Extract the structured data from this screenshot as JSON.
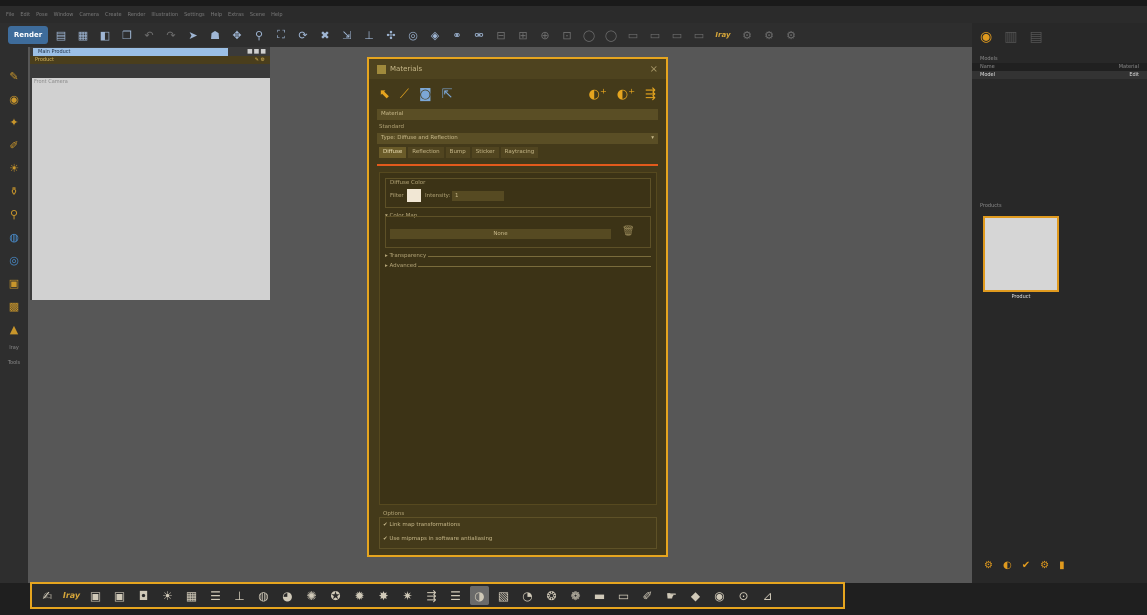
{
  "menubar": {
    "items": [
      "File",
      "Edit",
      "Pose",
      "Window",
      "Camera",
      "Create",
      "Render",
      "Illustration",
      "Settings",
      "Help",
      "Extras",
      "Scene",
      "Help"
    ]
  },
  "toolbar": {
    "render_label": "Render",
    "iray_label": "Iray"
  },
  "left_strip": {
    "label_a": "Iray",
    "label_b": "Tools"
  },
  "scene": {
    "tab_label": "Main Product",
    "controls": "■■■",
    "sub_label": "Product",
    "view_label": "Front Camera"
  },
  "right_panel": {
    "section_title": "Models",
    "header_cols": [
      "Name",
      "Material"
    ],
    "selected_row": [
      "Model",
      "Edit"
    ],
    "products_title": "Products",
    "product_label": "Product"
  },
  "dialog": {
    "title": "Materials",
    "close": "×",
    "material_field": "Material",
    "standard_label": "Standard",
    "type_label": "Type:",
    "type_value": "Diffuse and Reflection",
    "tabs": [
      "Diffuse",
      "Reflection",
      "Bump",
      "Sticker",
      "Raytracing"
    ],
    "diffuse_color": "Diffuse Color",
    "filter_label": "Filter",
    "intensity_label": "Intensity:",
    "intensity_value": "1",
    "color_map": "▾ Color Map",
    "map_value": "None",
    "transparency": "▸ Transparency",
    "advanced": "▸ Advanced",
    "options_title": "Options",
    "opt_link": "✔  Link map transformations",
    "opt_mipmaps": "✔  Use mipmaps in software antialiasing"
  },
  "dock": {
    "iray_label": "Iray"
  },
  "colors": {
    "accent": "#e6a51f",
    "dialog_bg": "#443a1a",
    "tab_underline": "#e25a1c"
  }
}
